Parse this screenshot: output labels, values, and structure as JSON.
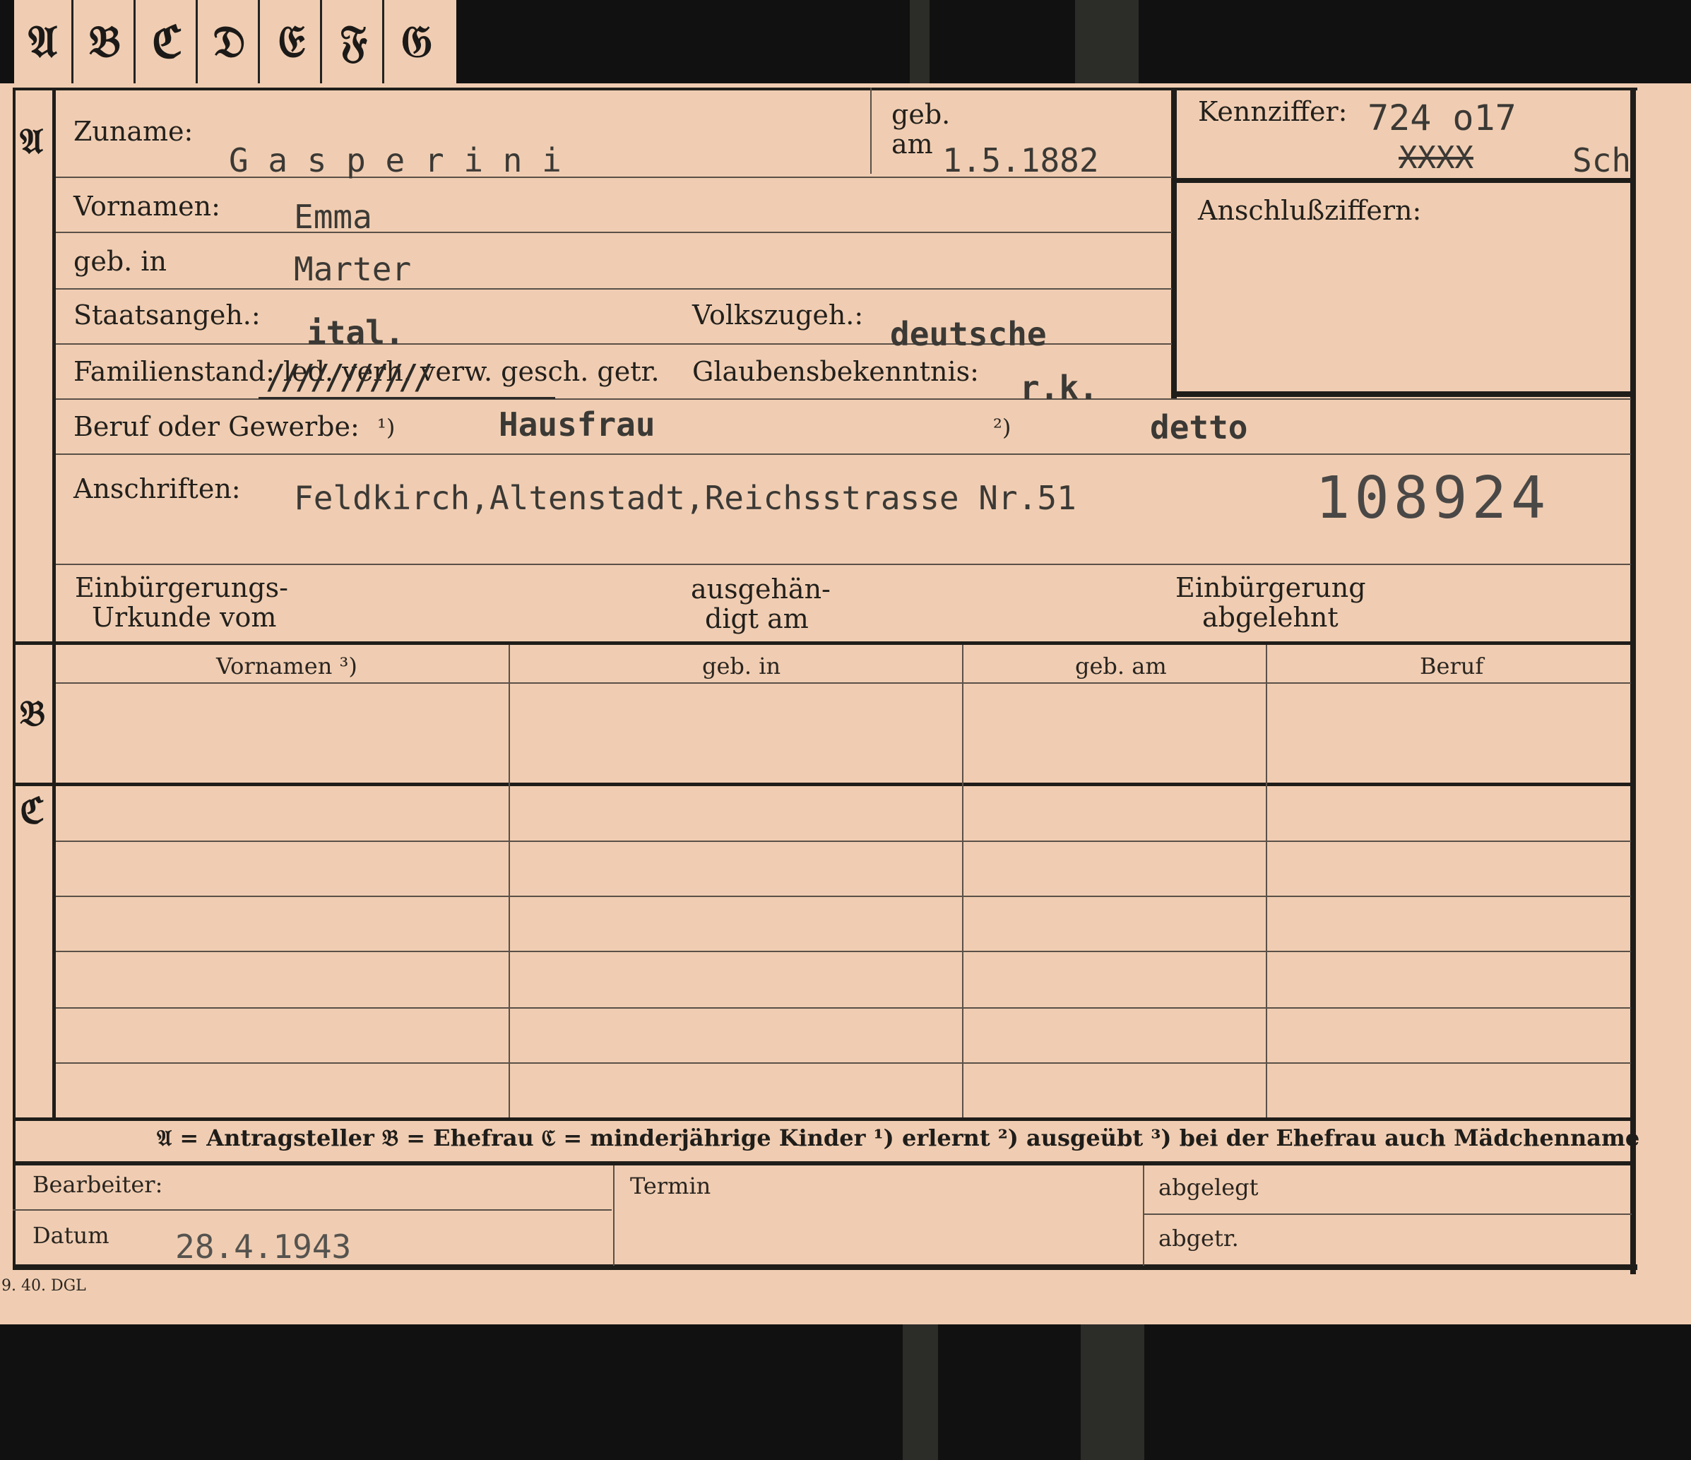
{
  "tabs": [
    "𝔄",
    "𝔅",
    "ℭ",
    "𝔇",
    "𝔈",
    "𝔉",
    "𝔊"
  ],
  "sections": {
    "a": "𝔄",
    "b": "𝔅",
    "c": "ℭ"
  },
  "labels": {
    "zuname": "Zuname:",
    "geb_top": "geb.",
    "geb_am": "am",
    "kennziffer": "Kennziffer:",
    "vornamen": "Vornamen:",
    "anschluss": "Anschlußziffern:",
    "geb_in": "geb. in",
    "staatsangeh": "Staatsangeh.:",
    "volkszugeh": "Volkszugeh.:",
    "familienstand": "Familienstand: led. verh. verw. gesch. getr.",
    "glaubensbekenntnis": "Glaubensbekenntnis:",
    "beruf": "Beruf oder Gewerbe:",
    "beruf_note1": "¹)",
    "beruf_note2": "²)",
    "anschriften": "Anschriften:",
    "einb_urkunde_1": "Einbürgerungs-",
    "einb_urkunde_2": "Urkunde vom",
    "ausgehaendigt_1": "ausgehän-",
    "ausgehaendigt_2": "digt am",
    "einb_abgelehnt_1": "Einbürgerung",
    "einb_abgelehnt_2": "abgelehnt"
  },
  "values": {
    "zuname": "G a s p e r i n i",
    "geb_am": "1.5.1882",
    "kennziffer": "724 o17",
    "kennziffer_strike": "XXXX",
    "kennziffer_suffix": "Sch",
    "vornamen": "Emma",
    "geb_in": "Marter",
    "staatsangeh": "ital.",
    "volkszugeh": "deutsche",
    "familienstand_strike": "///////////",
    "glaubensbekenntnis": "r.k.",
    "beruf_erlernt": "Hausfrau",
    "beruf_ausgeuebt": "detto",
    "anschriften": "Feldkirch,Altenstadt,Reichsstrasse Nr.51",
    "stamp_number": "108924",
    "datum": "28.4.1943"
  },
  "table": {
    "headers": [
      "Vornamen ³)",
      "geb. in",
      "geb. am",
      "Beruf"
    ]
  },
  "legend": "𝔄 = Antragsteller   𝔅 = Ehefrau   ℭ = minderjährige Kinder   ¹) erlernt   ²) ausgeübt   ³) bei der Ehefrau auch Mädchenname",
  "footer": {
    "bearbeiter": "Bearbeiter:",
    "termin": "Termin",
    "abgelegt": "abgelegt",
    "datum": "Datum",
    "abgetr": "abgetr.",
    "print_code": "9. 40. DGL"
  }
}
